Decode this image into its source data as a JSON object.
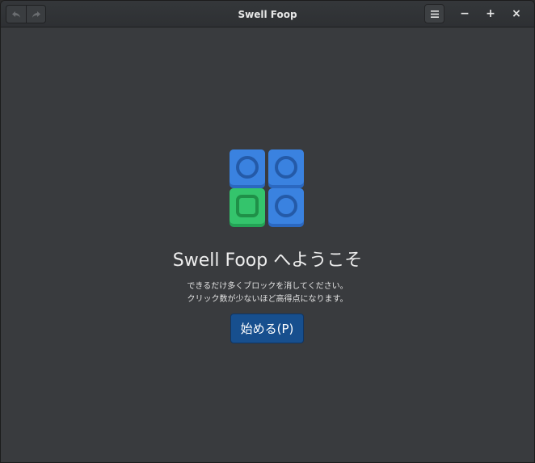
{
  "window": {
    "title": "Swell Foop"
  },
  "titlebar": {
    "undo_icon": "undo-arrow-icon",
    "redo_icon": "redo-arrow-icon",
    "menu_icon": "hamburger-menu-icon",
    "minimize_label": "−",
    "maximize_label": "+",
    "close_label": "×"
  },
  "welcome": {
    "heading": "Swell Foop へようこそ",
    "description_line1": "できるだけ多くブロックを消してください。",
    "description_line2": "クリック数が少ないほど高得点になります。",
    "start_button_label": "始める(P)"
  },
  "colors": {
    "window_bg": "#393b3e",
    "button_blue": "#174f8e",
    "block_blue": "#3a82e0",
    "block_green": "#34c46c"
  }
}
